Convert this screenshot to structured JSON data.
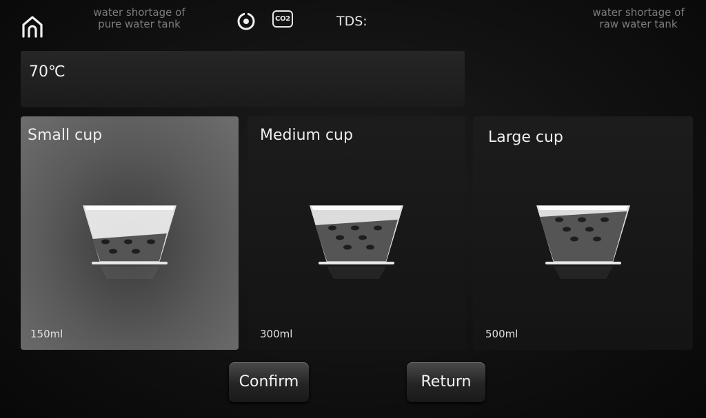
{
  "status_bar": {
    "pure_tank_warning": "water shortage of\npure water tank",
    "raw_tank_warning": "water shortage of\nraw water tank",
    "co2_label": "CO2",
    "tds_label": "TDS:"
  },
  "temperature": {
    "value": "70℃"
  },
  "cups": [
    {
      "label": "Small cup",
      "volume": "150ml",
      "fill_fraction": 0.45,
      "selected": true
    },
    {
      "label": "Medium cup",
      "volume": "300ml",
      "fill_fraction": 0.7,
      "selected": false
    },
    {
      "label": "Large cup",
      "volume": "500ml",
      "fill_fraction": 0.85,
      "selected": false
    }
  ],
  "actions": {
    "confirm_label": "Confirm",
    "return_label": "Return"
  },
  "icons": [
    "home-icon",
    "eye-icon",
    "co2-icon"
  ],
  "colors": {
    "accent": "#e6e6e6",
    "selected_card": "#5a5a5a",
    "dim_text": "#7d7d7d"
  }
}
